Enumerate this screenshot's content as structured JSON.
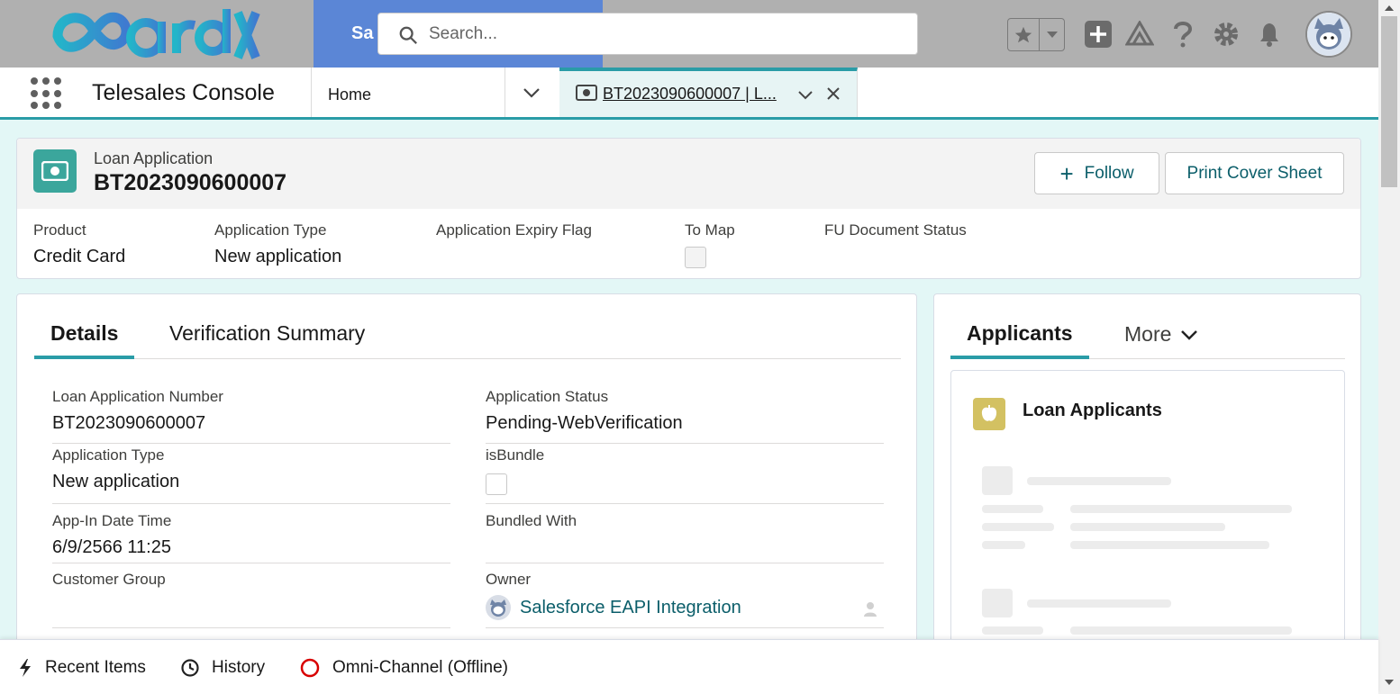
{
  "header": {
    "logo_text": "CardX",
    "blue_block_text": "Sa",
    "search_placeholder": "Search...",
    "icons": [
      "star-icon",
      "chevron-down-icon",
      "add-icon",
      "trailhead-icon",
      "help-icon",
      "gear-icon",
      "bell-icon",
      "avatar"
    ]
  },
  "nav": {
    "app_name": "Telesales Console",
    "home_tab": "Home",
    "record_tab_label": "BT2023090600007 | L..."
  },
  "record": {
    "object_type": "Loan Application",
    "title": "BT2023090600007",
    "follow_label": "Follow",
    "print_label": "Print Cover Sheet",
    "highlights": {
      "product_label": "Product",
      "product_value": "Credit Card",
      "app_type_label": "Application Type",
      "app_type_value": "New application",
      "expiry_label": "Application Expiry Flag",
      "to_map_label": "To Map",
      "fu_label": "FU Document Status"
    }
  },
  "details": {
    "tab_details": "Details",
    "tab_verification": "Verification Summary",
    "fields": {
      "loan_number_label": "Loan Application Number",
      "loan_number_value": "BT2023090600007",
      "app_status_label": "Application Status",
      "app_status_value": "Pending-WebVerification",
      "app_type_label": "Application Type",
      "app_type_value": "New application",
      "isbundle_label": "isBundle",
      "app_in_label": "App-In Date Time",
      "app_in_value": "6/9/2566 11:25",
      "bundled_label": "Bundled With",
      "customer_group_label": "Customer Group",
      "owner_label": "Owner",
      "owner_value": "Salesforce EAPI Integration"
    }
  },
  "applicants": {
    "tab_active": "Applicants",
    "tab_more": "More",
    "card_title": "Loan Applicants"
  },
  "utility": {
    "recent": "Recent Items",
    "history": "History",
    "omni": "Omni-Channel (Offline)"
  },
  "colors": {
    "accent": "#2a9ca7",
    "record_icon": "#3ba69c",
    "related_icon": "#d3c162",
    "link": "#0b5e6a"
  }
}
